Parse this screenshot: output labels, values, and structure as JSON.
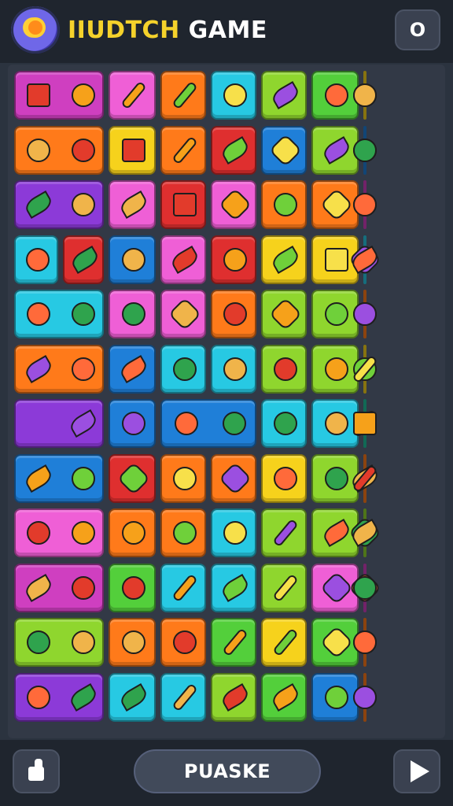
{
  "header": {
    "title_part1": "IIUDTCH",
    "title_part2": "GAME",
    "settings_icon_name": "restart-icon",
    "settings_label": "O"
  },
  "board": {
    "colors": {
      "magenta": "#cf3fc0",
      "pink": "#ef5fd6",
      "orange": "#ff7a1a",
      "cyan": "#27c9e3",
      "lime": "#8fd62e",
      "green": "#53cf3b",
      "yellow": "#f6d21c",
      "red": "#df2f2f",
      "blue": "#1f7fd8",
      "purple": "#8c3ad8",
      "teal": "#1fbf9c"
    },
    "tiles": [
      {
        "row": 0,
        "span": [
          0,
          2
        ],
        "color": "magenta",
        "icons": [
          "box-icon",
          "apple-icon"
        ]
      },
      {
        "row": 0,
        "span": [
          2,
          3
        ],
        "color": "pink",
        "icons": [
          "pencil-icon"
        ]
      },
      {
        "row": 0,
        "span": [
          3,
          4
        ],
        "color": "orange",
        "icons": [
          "pencil-icon"
        ]
      },
      {
        "row": 0,
        "span": [
          4,
          5
        ],
        "color": "cyan",
        "icons": [
          "smiley-icon"
        ]
      },
      {
        "row": 0,
        "span": [
          5,
          6
        ],
        "color": "lime",
        "icons": [
          "leaf-icon"
        ]
      },
      {
        "row": 0,
        "span": [
          6,
          7
        ],
        "color": "green",
        "icons": [
          "blob-icon"
        ]
      },
      {
        "row": 0,
        "span": [
          7,
          9
        ],
        "color": "yellow",
        "icons": [
          "swirl-icon",
          "orange-icon"
        ]
      },
      {
        "row": 1,
        "span": [
          0,
          2
        ],
        "color": "orange",
        "icons": [
          "pot-icon",
          "apple-icon"
        ]
      },
      {
        "row": 1,
        "span": [
          2,
          3
        ],
        "color": "yellow",
        "icons": [
          "bin-icon"
        ]
      },
      {
        "row": 1,
        "span": [
          3,
          4
        ],
        "color": "orange",
        "icons": [
          "carrot-icon"
        ]
      },
      {
        "row": 1,
        "span": [
          4,
          5
        ],
        "color": "red",
        "icons": [
          "banana-icon"
        ]
      },
      {
        "row": 1,
        "span": [
          5,
          6
        ],
        "color": "blue",
        "icons": [
          "gem-icon"
        ]
      },
      {
        "row": 1,
        "span": [
          6,
          7
        ],
        "color": "lime",
        "icons": [
          "mango-icon"
        ]
      },
      {
        "row": 1,
        "span": [
          7,
          9
        ],
        "color": "blue",
        "icons": [
          "crab-icon",
          "lemon-icon"
        ]
      },
      {
        "row": 2,
        "span": [
          0,
          2
        ],
        "color": "purple",
        "icons": [
          "banana-icon",
          "sparkle-icon"
        ]
      },
      {
        "row": 2,
        "span": [
          2,
          3
        ],
        "color": "pink",
        "icons": [
          "cucumber-icon"
        ]
      },
      {
        "row": 2,
        "span": [
          3,
          4
        ],
        "color": "red",
        "icons": [
          "crate-icon"
        ]
      },
      {
        "row": 2,
        "span": [
          4,
          5
        ],
        "color": "pink",
        "icons": [
          "sun-icon"
        ]
      },
      {
        "row": 2,
        "span": [
          5,
          6
        ],
        "color": "orange",
        "icons": [
          "coin-icon"
        ]
      },
      {
        "row": 2,
        "span": [
          6,
          7
        ],
        "color": "orange",
        "icons": [
          "map-icon"
        ]
      },
      {
        "row": 2,
        "span": [
          7,
          9
        ],
        "color": "magenta",
        "icons": [
          "face-icon",
          "lemon-icon"
        ]
      },
      {
        "row": 3,
        "span": [
          0,
          1
        ],
        "color": "cyan",
        "icons": [
          "smiley-icon"
        ]
      },
      {
        "row": 3,
        "span": [
          1,
          2
        ],
        "color": "red",
        "icons": [
          "leaf-icon"
        ]
      },
      {
        "row": 3,
        "span": [
          2,
          3
        ],
        "color": "blue",
        "icons": [
          "smiley-icon"
        ]
      },
      {
        "row": 3,
        "span": [
          3,
          4
        ],
        "color": "pink",
        "icons": [
          "bread-icon"
        ]
      },
      {
        "row": 3,
        "span": [
          4,
          5
        ],
        "color": "red",
        "icons": [
          "brain-icon"
        ]
      },
      {
        "row": 3,
        "span": [
          5,
          6
        ],
        "color": "yellow",
        "icons": [
          "leaf-icon"
        ]
      },
      {
        "row": 3,
        "span": [
          6,
          7
        ],
        "color": "yellow",
        "icons": [
          "cake-icon"
        ]
      },
      {
        "row": 3,
        "span": [
          7,
          9
        ],
        "color": "cyan",
        "icons": [
          "sun-icon",
          "pepper-icon"
        ]
      },
      {
        "row": 4,
        "span": [
          0,
          2
        ],
        "color": "cyan",
        "icons": [
          "smiley-icon",
          "orange-icon"
        ]
      },
      {
        "row": 4,
        "span": [
          2,
          3
        ],
        "color": "pink",
        "icons": [
          "smiley-icon"
        ]
      },
      {
        "row": 4,
        "span": [
          3,
          4
        ],
        "color": "pink",
        "icons": [
          "sun-icon"
        ]
      },
      {
        "row": 4,
        "span": [
          4,
          5
        ],
        "color": "orange",
        "icons": [
          "potato-icon"
        ]
      },
      {
        "row": 4,
        "span": [
          5,
          6
        ],
        "color": "lime",
        "icons": [
          "splat-icon"
        ]
      },
      {
        "row": 4,
        "span": [
          6,
          7
        ],
        "color": "lime",
        "icons": [
          "orange-icon"
        ]
      },
      {
        "row": 4,
        "span": [
          7,
          9
        ],
        "color": "orange",
        "icons": [
          "plum-icon",
          "apple-icon"
        ]
      },
      {
        "row": 5,
        "span": [
          0,
          2
        ],
        "color": "orange",
        "icons": [
          "cucumber-icon",
          "seed-icon"
        ]
      },
      {
        "row": 5,
        "span": [
          2,
          3
        ],
        "color": "blue",
        "icons": [
          "banana-icon"
        ]
      },
      {
        "row": 5,
        "span": [
          3,
          4
        ],
        "color": "cyan",
        "icons": [
          "mushroom-icon"
        ]
      },
      {
        "row": 5,
        "span": [
          4,
          5
        ],
        "color": "cyan",
        "icons": [
          "apple-icon"
        ]
      },
      {
        "row": 5,
        "span": [
          5,
          6
        ],
        "color": "lime",
        "icons": [
          "apple-icon"
        ]
      },
      {
        "row": 5,
        "span": [
          6,
          7
        ],
        "color": "lime",
        "icons": [
          "apple-icon"
        ]
      },
      {
        "row": 5,
        "span": [
          7,
          9
        ],
        "color": "yellow",
        "icons": [
          "apple-icon",
          "stick-icon"
        ]
      },
      {
        "row": 6,
        "span": [
          0,
          2
        ],
        "color": "purple",
        "icons": [
          "empty",
          "pepper-icon"
        ]
      },
      {
        "row": 6,
        "span": [
          2,
          3
        ],
        "color": "blue",
        "icons": [
          "eggplant-icon"
        ]
      },
      {
        "row": 6,
        "span": [
          3,
          5
        ],
        "color": "blue",
        "icons": [
          "lemon-icon",
          "grape-icon"
        ]
      },
      {
        "row": 6,
        "span": [
          5,
          6
        ],
        "color": "cyan",
        "icons": [
          "avocado-icon"
        ]
      },
      {
        "row": 6,
        "span": [
          6,
          7
        ],
        "color": "cyan",
        "icons": [
          "herb-icon"
        ]
      },
      {
        "row": 6,
        "span": [
          7,
          9
        ],
        "color": "teal",
        "icons": [
          "carrot-icon",
          "cup-icon"
        ]
      },
      {
        "row": 7,
        "span": [
          0,
          2
        ],
        "color": "blue",
        "icons": [
          "pea-icon",
          "seed-icon"
        ]
      },
      {
        "row": 7,
        "span": [
          2,
          3
        ],
        "color": "red",
        "icons": [
          "flower-icon"
        ]
      },
      {
        "row": 7,
        "span": [
          3,
          4
        ],
        "color": "orange",
        "icons": [
          "orange-icon"
        ]
      },
      {
        "row": 7,
        "span": [
          4,
          5
        ],
        "color": "orange",
        "icons": [
          "splat-icon"
        ]
      },
      {
        "row": 7,
        "span": [
          5,
          6
        ],
        "color": "yellow",
        "icons": [
          "moon-icon"
        ]
      },
      {
        "row": 7,
        "span": [
          6,
          7
        ],
        "color": "lime",
        "icons": [
          "plum-icon"
        ]
      },
      {
        "row": 7,
        "span": [
          7,
          9
        ],
        "color": "orange",
        "icons": [
          "banana-icon",
          "bottle-icon"
        ]
      },
      {
        "row": 8,
        "span": [
          0,
          2
        ],
        "color": "pink",
        "icons": [
          "donut-icon",
          "orange-icon"
        ]
      },
      {
        "row": 8,
        "span": [
          2,
          3
        ],
        "color": "orange",
        "icons": [
          "sack-icon"
        ]
      },
      {
        "row": 8,
        "span": [
          3,
          4
        ],
        "color": "orange",
        "icons": [
          "cross-icon"
        ]
      },
      {
        "row": 8,
        "span": [
          4,
          5
        ],
        "color": "cyan",
        "icons": [
          "lime-icon"
        ]
      },
      {
        "row": 8,
        "span": [
          5,
          6
        ],
        "color": "lime",
        "icons": [
          "pencil-icon"
        ]
      },
      {
        "row": 8,
        "span": [
          6,
          7
        ],
        "color": "lime",
        "icons": [
          "pickle-icon"
        ]
      },
      {
        "row": 8,
        "span": [
          7,
          9
        ],
        "color": "lime",
        "icons": [
          "splat-icon",
          "pepper-icon"
        ]
      },
      {
        "row": 9,
        "span": [
          0,
          2
        ],
        "color": "magenta",
        "icons": [
          "bread-icon",
          "bug-icon"
        ]
      },
      {
        "row": 9,
        "span": [
          2,
          3
        ],
        "color": "green",
        "icons": [
          "apple-icon"
        ]
      },
      {
        "row": 9,
        "span": [
          3,
          4
        ],
        "color": "cyan",
        "icons": [
          "pickaxe-icon"
        ]
      },
      {
        "row": 9,
        "span": [
          4,
          5
        ],
        "color": "cyan",
        "icons": [
          "leaf-icon"
        ]
      },
      {
        "row": 9,
        "span": [
          5,
          6
        ],
        "color": "lime",
        "icons": [
          "carrot-icon"
        ]
      },
      {
        "row": 9,
        "span": [
          6,
          7
        ],
        "color": "pink",
        "icons": [
          "gear-icon"
        ]
      },
      {
        "row": 9,
        "span": [
          7,
          9
        ],
        "color": "magenta",
        "icons": [
          "star-icon",
          "shell-icon"
        ]
      },
      {
        "row": 10,
        "span": [
          0,
          2
        ],
        "color": "lime",
        "icons": [
          "smiley-icon",
          "orange-icon"
        ]
      },
      {
        "row": 10,
        "span": [
          2,
          3
        ],
        "color": "orange",
        "icons": [
          "smiley-icon"
        ]
      },
      {
        "row": 10,
        "span": [
          3,
          4
        ],
        "color": "orange",
        "icons": [
          "smiley-icon"
        ]
      },
      {
        "row": 10,
        "span": [
          4,
          5
        ],
        "color": "green",
        "icons": [
          "pencil-icon"
        ]
      },
      {
        "row": 10,
        "span": [
          5,
          6
        ],
        "color": "yellow",
        "icons": [
          "pencil-icon"
        ]
      },
      {
        "row": 10,
        "span": [
          6,
          7
        ],
        "color": "green",
        "icons": [
          "splat-icon"
        ]
      },
      {
        "row": 10,
        "span": [
          7,
          9
        ],
        "color": "orange",
        "icons": [
          "orange-icon",
          "apple-icon"
        ]
      },
      {
        "row": 11,
        "span": [
          0,
          2
        ],
        "color": "purple",
        "icons": [
          "garlic-icon",
          "pear-icon"
        ]
      },
      {
        "row": 11,
        "span": [
          2,
          3
        ],
        "color": "cyan",
        "icons": [
          "mango-icon"
        ]
      },
      {
        "row": 11,
        "span": [
          3,
          4
        ],
        "color": "cyan",
        "icons": [
          "carrot-icon"
        ]
      },
      {
        "row": 11,
        "span": [
          4,
          5
        ],
        "color": "lime",
        "icons": [
          "pear-icon"
        ]
      },
      {
        "row": 11,
        "span": [
          5,
          6
        ],
        "color": "green",
        "icons": [
          "leaf-icon"
        ]
      },
      {
        "row": 11,
        "span": [
          6,
          7
        ],
        "color": "blue",
        "icons": [
          "bacon-icon"
        ]
      },
      {
        "row": 11,
        "span": [
          7,
          9
        ],
        "color": "orange",
        "icons": [
          "bacon-icon",
          "lemon-icon"
        ]
      }
    ]
  },
  "footer": {
    "like_icon_name": "thumbs-up-icon",
    "pause_label": "PUASKE",
    "play_icon_name": "play-icon"
  }
}
